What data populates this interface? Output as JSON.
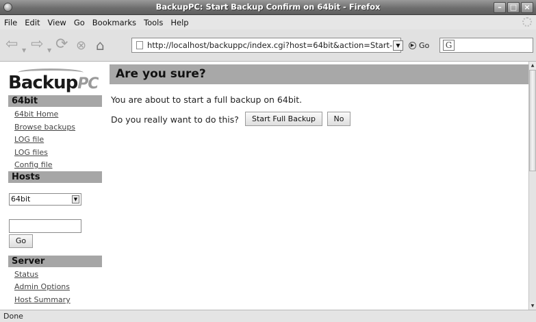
{
  "window": {
    "title": "BackupPC: Start Backup Confirm on 64bit - Firefox"
  },
  "menubar": {
    "items": [
      {
        "label": "File"
      },
      {
        "label": "Edit"
      },
      {
        "label": "View"
      },
      {
        "label": "Go"
      },
      {
        "label": "Bookmarks"
      },
      {
        "label": "Tools"
      },
      {
        "label": "Help"
      }
    ]
  },
  "toolbar": {
    "url": "http://localhost/backuppc/index.cgi?host=64bit&action=Start-",
    "go_label": "Go",
    "search_engine_glyph": "G"
  },
  "logo": {
    "main": "Backup",
    "suffix": "PC"
  },
  "sidebar": {
    "host_header": "64bit",
    "host_links": [
      {
        "label": "64bit Home"
      },
      {
        "label": "Browse backups"
      },
      {
        "label": "LOG file"
      },
      {
        "label": "LOG files"
      },
      {
        "label": "Config file"
      }
    ],
    "hosts_header": "Hosts",
    "host_select_value": "64bit",
    "host_input_value": "",
    "go_button": "Go",
    "server_header": "Server",
    "server_links": [
      {
        "label": "Status"
      },
      {
        "label": "Admin Options"
      },
      {
        "label": "Host Summary"
      }
    ]
  },
  "main": {
    "heading": "Are you sure?",
    "message": "You are about to start a full backup on 64bit.",
    "question": "Do you really want to do this?",
    "confirm_button": "Start Full Backup",
    "cancel_button": "No"
  },
  "status": {
    "text": "Done"
  },
  "icons": {
    "back": "back-arrow-icon",
    "forward": "forward-arrow-icon",
    "reload": "reload-icon",
    "stop": "stop-icon",
    "home": "home-icon"
  }
}
